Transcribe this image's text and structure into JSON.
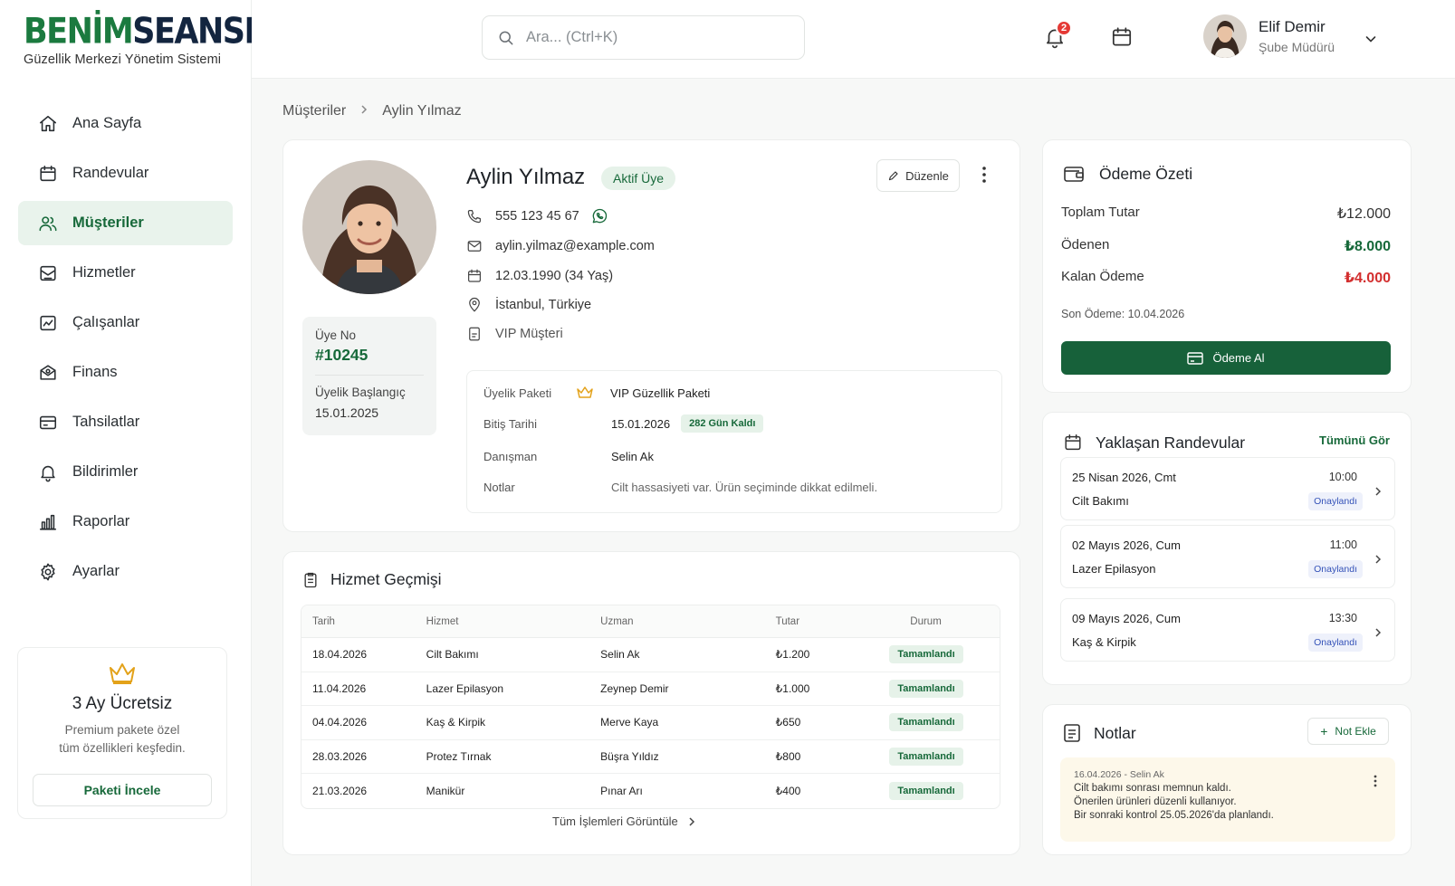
{
  "brand": {
    "logo_part1": "BENİM",
    "logo_part2": "SEANSIM",
    "subtitle": "Güzellik Merkezi Yönetim Sistemi",
    "primary_color": "#17693a",
    "navy_color": "#13253f"
  },
  "sidebar": {
    "items": [
      {
        "label": "Ana Sayfa",
        "icon": "home-icon"
      },
      {
        "label": "Randevular",
        "icon": "calendar-icon"
      },
      {
        "label": "Müşteriler",
        "icon": "users-icon",
        "active": true
      },
      {
        "label": "Hizmetler",
        "icon": "services-icon"
      },
      {
        "label": "Çalışanlar",
        "icon": "staff-icon"
      },
      {
        "label": "Finans",
        "icon": "finance-icon"
      },
      {
        "label": "Tahsilatlar",
        "icon": "card-icon"
      },
      {
        "label": "Bildirimler",
        "icon": "bell-icon"
      },
      {
        "label": "Raporlar",
        "icon": "chart-icon"
      },
      {
        "label": "Ayarlar",
        "icon": "gear-icon"
      }
    ],
    "promo": {
      "title": "3 Ay Ücretsiz",
      "line1": "Premium pakete özel",
      "line2": "tüm özellikleri keşfedin.",
      "button": "Paketi İncele"
    }
  },
  "header": {
    "search_placeholder": "Ara... (Ctrl+K)",
    "notification_count": "2",
    "user": {
      "name": "Elif Demir",
      "role": "Şube Müdürü"
    }
  },
  "breadcrumb": {
    "parent": "Müşteriler",
    "current": "Aylin Yılmaz"
  },
  "profile": {
    "name": "Aylin Yılmaz",
    "status": "Aktif Üye",
    "edit_label": "Düzenle",
    "phone": "555 123 45 67",
    "email": "aylin.yilmaz@example.com",
    "birth": "12.03.1990 (34 Yaş)",
    "location": "İstanbul, Türkiye",
    "segment": "VIP Müşteri",
    "member_no_label": "Üye No",
    "member_no": "#10245",
    "member_since_label": "Üyelik Başlangıç",
    "member_since": "15.01.2025",
    "package": {
      "package_label": "Üyelik Paketi",
      "package_value": "VIP Güzellik Paketi",
      "end_label": "Bitiş Tarihi",
      "end_value": "15.01.2026",
      "days_left": "282 Gün Kaldı",
      "advisor_label": "Danışman",
      "advisor_value": "Selin Ak",
      "notes_label": "Notlar",
      "notes_value": "Cilt hassasiyeti var. Ürün seçiminde dikkat edilmeli."
    }
  },
  "history": {
    "title": "Hizmet Geçmişi",
    "columns": [
      "Tarih",
      "Hizmet",
      "Uzman",
      "Tutar",
      "Durum"
    ],
    "rows": [
      [
        "18.04.2026",
        "Cilt Bakımı",
        "Selin Ak",
        "₺1.200",
        "Tamamlandı"
      ],
      [
        "11.04.2026",
        "Lazer Epilasyon",
        "Zeynep Demir",
        "₺1.000",
        "Tamamlandı"
      ],
      [
        "04.04.2026",
        "Kaş & Kirpik",
        "Merve Kaya",
        "₺650",
        "Tamamlandı"
      ],
      [
        "28.03.2026",
        "Protez Tırnak",
        "Büşra Yıldız",
        "₺800",
        "Tamamlandı"
      ],
      [
        "21.03.2026",
        "Manikür",
        "Pınar Arı",
        "₺400",
        "Tamamlandı"
      ]
    ],
    "view_all": "Tüm İşlemleri Görüntüle"
  },
  "payment": {
    "title": "Ödeme Özeti",
    "total_label": "Toplam Tutar",
    "total_value": "₺12.000",
    "paid_label": "Ödenen",
    "paid_value": "₺8.000",
    "remaining_label": "Kalan Ödeme",
    "remaining_value": "₺4.000",
    "last_payment": "Son Ödeme: 10.04.2026",
    "button": "Ödeme Al",
    "paid_color": "#17693a",
    "remaining_color": "#d32f2f"
  },
  "appointments": {
    "title": "Yaklaşan Randevular",
    "view_all": "Tümünü Gör",
    "items": [
      {
        "date": "25 Nisan 2026, Cmt",
        "service": "Cilt Bakımı",
        "time": "10:00",
        "status": "Onaylandı"
      },
      {
        "date": "02 Mayıs 2026, Cum",
        "service": "Lazer Epilasyon",
        "time": "11:00",
        "status": "Onaylandı"
      },
      {
        "date": "09 Mayıs 2026, Cum",
        "service": "Kaş & Kirpik",
        "time": "13:30",
        "status": "Onaylandı"
      }
    ]
  },
  "notes": {
    "title": "Notlar",
    "add": "Not Ekle",
    "item": {
      "meta": "16.04.2026 - Selin Ak",
      "line1": "Cilt bakımı sonrası memnun kaldı.",
      "line2": "Önerilen ürünleri düzenli kullanıyor.",
      "line3": "Bir sonraki kontrol 25.05.2026'da planlandı."
    }
  }
}
